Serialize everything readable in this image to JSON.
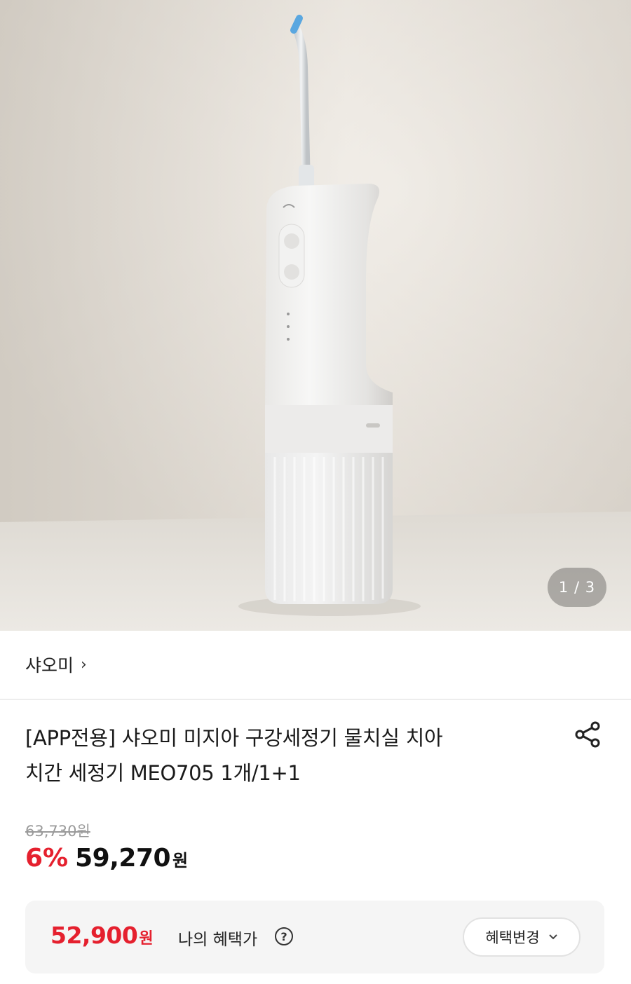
{
  "gallery": {
    "counter": "1 / 3"
  },
  "brand": {
    "name": "샤오미",
    "chevron": "›"
  },
  "product": {
    "title_line1": "[APP전용] 샤오미 미지아 구강세정기 물치실 치아",
    "title_line2": "치간 세정기 MEO705 1개/1+1"
  },
  "pricing": {
    "original_price": "63,730원",
    "discount_rate": "6%",
    "sale_price": "59,270",
    "currency": "원"
  },
  "benefit": {
    "amount": "52,900",
    "currency": "원",
    "label": "나의 혜택가",
    "help": "?",
    "change_button": "혜택변경",
    "chevron": "⌄"
  },
  "colors": {
    "discount_red": "#e5202e",
    "benefit_bg": "#f5f5f5"
  },
  "icons": [
    "share-icon",
    "question-icon",
    "chevron-right-icon",
    "chevron-down-icon"
  ]
}
